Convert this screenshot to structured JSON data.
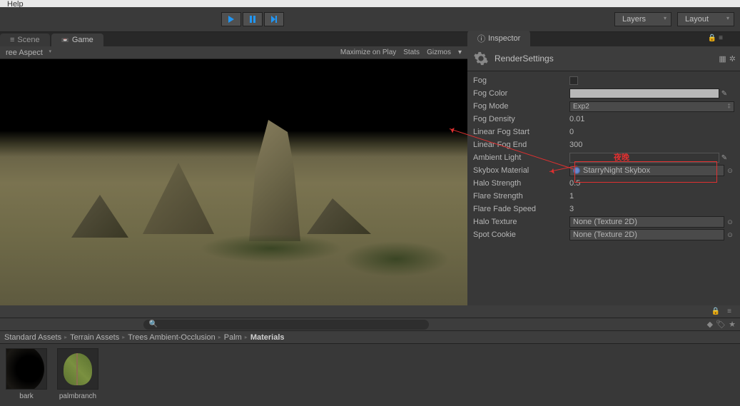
{
  "menu": {
    "help": "Help"
  },
  "toolbar": {
    "layers_label": "Layers",
    "layout_label": "Layout"
  },
  "tabs": {
    "scene": "Scene",
    "game": "Game"
  },
  "game_toolbar": {
    "aspect": "ree Aspect",
    "maximize": "Maximize on Play",
    "stats": "Stats",
    "gizmos": "Gizmos"
  },
  "inspector": {
    "tab_label": "Inspector",
    "title": "RenderSettings",
    "props": {
      "fog_label": "Fog",
      "fog_color_label": "Fog Color",
      "fog_mode_label": "Fog Mode",
      "fog_mode_value": "Exp2",
      "fog_density_label": "Fog Density",
      "fog_density_value": "0.01",
      "linear_fog_start_label": "Linear Fog Start",
      "linear_fog_start_value": "0",
      "linear_fog_end_label": "Linear Fog End",
      "linear_fog_end_value": "300",
      "ambient_light_label": "Ambient Light",
      "skybox_material_label": "Skybox Material",
      "skybox_material_value": "StarryNight Skybox",
      "halo_strength_label": "Halo Strength",
      "halo_strength_value": "0.5",
      "flare_strength_label": "Flare Strength",
      "flare_strength_value": "1",
      "flare_fade_speed_label": "Flare Fade Speed",
      "flare_fade_speed_value": "3",
      "halo_texture_label": "Halo Texture",
      "halo_texture_value": "None (Texture 2D)",
      "spot_cookie_label": "Spot Cookie",
      "spot_cookie_value": "None (Texture 2D)"
    }
  },
  "annotation": {
    "text": "夜晚"
  },
  "breadcrumb": {
    "items": [
      "Standard Assets",
      "Terrain Assets",
      "Trees Ambient-Occlusion",
      "Palm"
    ],
    "current": "Materials"
  },
  "assets": {
    "bark": "bark",
    "palmbranch": "palmbranch"
  }
}
